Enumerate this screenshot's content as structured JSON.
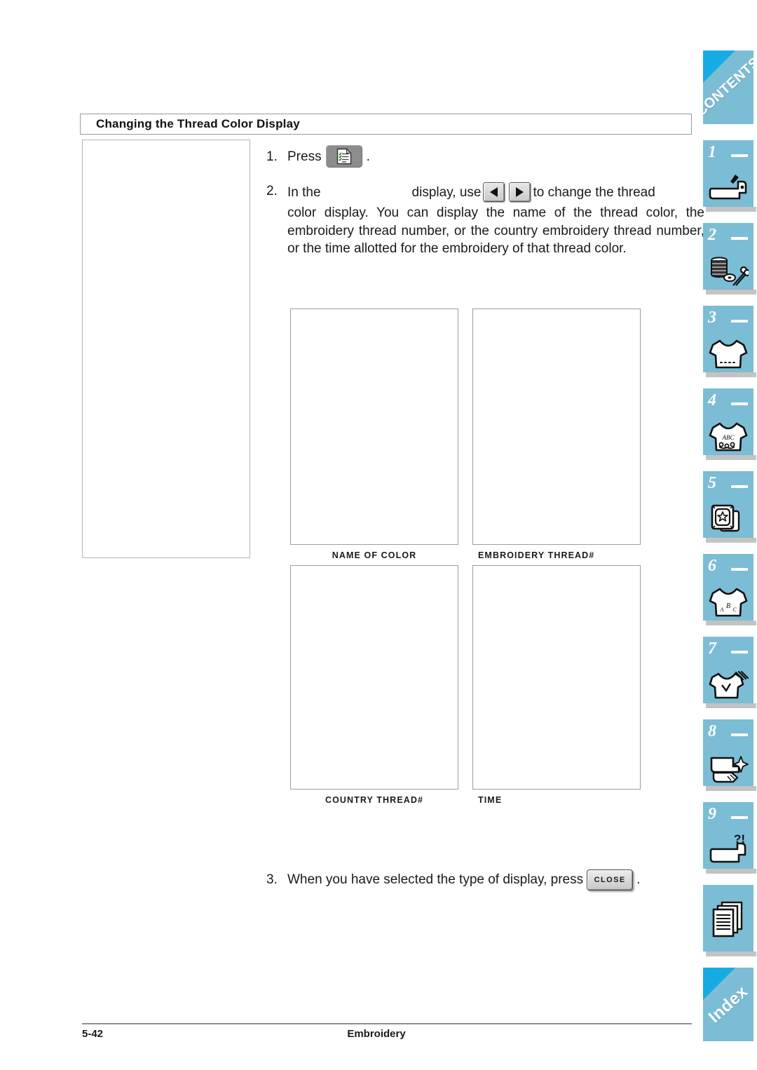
{
  "section": {
    "heading": "Changing the Thread Color Display"
  },
  "steps": {
    "step1": {
      "number": "1.",
      "text_before": "Press",
      "button_icon": "thread-color-display-icon",
      "text_after": "."
    },
    "step2": {
      "number": "2.",
      "line_start": "In the",
      "line_mid": "display, use",
      "button_left_icon": "left-arrow-icon",
      "button_right_icon": "right-arrow-icon",
      "line_end": "to change the thread",
      "paragraph": "color display. You can display the name of the thread color, the embroidery thread number, or the country embroidery thread number, or the time allotted for the embroidery of that thread color."
    },
    "step3": {
      "number": "3.",
      "text_before": "When you have selected the type of display, press",
      "button_label": "CLOSE",
      "text_after": "."
    }
  },
  "samples": [
    {
      "caption": "NAME OF COLOR",
      "align": "center"
    },
    {
      "caption": "EMBROIDERY THREAD#",
      "align": "left"
    },
    {
      "caption": "COUNTRY THREAD#",
      "align": "center"
    },
    {
      "caption": "TIME",
      "align": "left"
    }
  ],
  "footer": {
    "page_number": "5-42",
    "document_name": "Embroidery"
  },
  "tab_rail": {
    "accent_color": "#7bbdd4",
    "corner_color": "#16ace3",
    "tabs": [
      {
        "type": "corner",
        "label": "CONTENTS",
        "icon": "contents-tab"
      },
      {
        "type": "numbered",
        "label": "1",
        "icon": "sewing-machine-icon"
      },
      {
        "type": "numbered",
        "label": "2",
        "icon": "spool-and-scissors-icon"
      },
      {
        "type": "numbered",
        "label": "3",
        "icon": "tshirt-icon"
      },
      {
        "type": "numbered",
        "label": "4",
        "icon": "tshirt-abc-icon"
      },
      {
        "type": "numbered",
        "label": "5",
        "icon": "embroidery-card-icon"
      },
      {
        "type": "numbered",
        "label": "6",
        "icon": "tshirt-letters-icon"
      },
      {
        "type": "numbered",
        "label": "7",
        "icon": "tshirt-tools-icon"
      },
      {
        "type": "numbered",
        "label": "8",
        "icon": "machine-cleaning-icon"
      },
      {
        "type": "numbered",
        "label": "9",
        "icon": "machine-question-icon"
      },
      {
        "type": "plain",
        "label": "",
        "icon": "document-stack-icon"
      },
      {
        "type": "corner",
        "label": "Index",
        "icon": "index-tab"
      }
    ]
  }
}
